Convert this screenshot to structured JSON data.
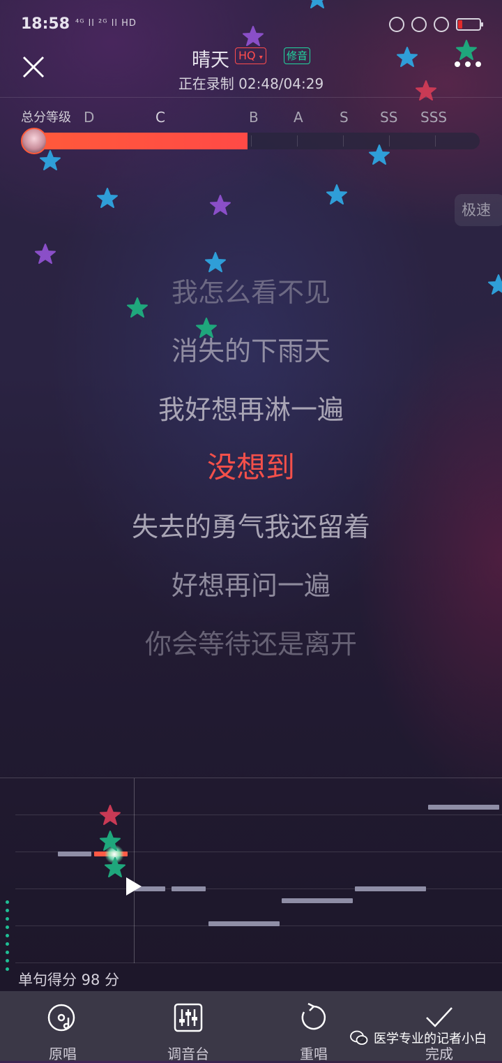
{
  "status_bar": {
    "time": "18:58",
    "network": "⁴ᴳ ll ²ᴳ ll HD"
  },
  "header": {
    "song_title": "晴天",
    "quality_badge": "HQ",
    "tune_badge": "修音",
    "recording_status": "正在录制 02:48/04:29"
  },
  "score": {
    "label": "总分等级",
    "grades": [
      "D",
      "C",
      "B",
      "A",
      "S",
      "SS",
      "SSS"
    ],
    "progress_fraction": 0.49,
    "colors": {
      "bar": "#ff4a46"
    }
  },
  "speed_button": "极速",
  "lyrics": {
    "previous": [
      "我怎么看不见",
      "消失的下雨天",
      "我好想再淋一遍"
    ],
    "current": "没想到",
    "next": [
      "失去的勇气我还留着",
      "好想再问一遍",
      "你会等待还是离开"
    ]
  },
  "sentence_score": "单句得分 98 分",
  "toolbar": {
    "original_label": "原唱",
    "mixer_label": "调音台",
    "retry_label": "重唱",
    "done_label": "完成"
  },
  "watermark": "医学专业的记者小白"
}
